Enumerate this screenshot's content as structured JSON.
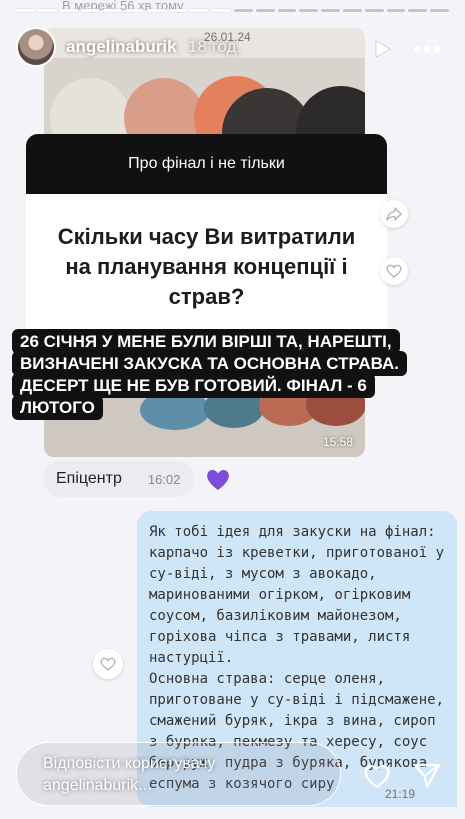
{
  "chat": {
    "status": "В мережі 56 хв тому",
    "photo_date": "26.01.24",
    "photo_time": "15:58",
    "quote_header": "Про фінал і не тільки",
    "quote_question": "Скільки часу Ви витратили на планування концепції і страв?",
    "left_bubble": {
      "text": "Епіцентр",
      "time": "16:02"
    },
    "right_bubble": {
      "lines": [
        "Як тобі ідея для закуски на фінал:",
        "карпачо із креветки, приготованої у",
        "су-віді, з мусом з авокадо,",
        "маринованими огірком, огірковим",
        "соусом, базиліковим майонезом,",
        "горіхова чіпса з травами, листя",
        "настурції.",
        "Основна страва: серце оленя,",
        "приготоване у су-віді і підсмажене,",
        "смажений буряк, ікра з вина, сироп",
        "з буряка, пекмезу та хересу, соус",
        "бер-руж, пудра з буряка, бурякова",
        "еспума з козячого сиру"
      ],
      "time": "21:19"
    }
  },
  "story": {
    "username": "angelinaburik",
    "age": "18 год.",
    "progress_total": 20,
    "progress_done": 10,
    "caption_lines": [
      "26 СІЧНЯ У МЕНЕ БУЛИ ВІРШІ ТА, НАРЕШТІ,",
      "ВИЗНАЧЕНІ ЗАКУСКА ТА ОСНОВНА СТРАВА.",
      "ДЕСЕРТ ЩЕ НЕ БУВ ГОТОВИЙ. ФІНАЛ - 6",
      "ЛЮТОГО"
    ]
  },
  "reply": {
    "line1": "Відповісти користувачу",
    "line2": "angelinaburik..."
  },
  "colors": {
    "reaction_heart": "#7b4dd8",
    "bubble_out": "#cfe5f8",
    "bubble_in": "#ecebf1"
  }
}
